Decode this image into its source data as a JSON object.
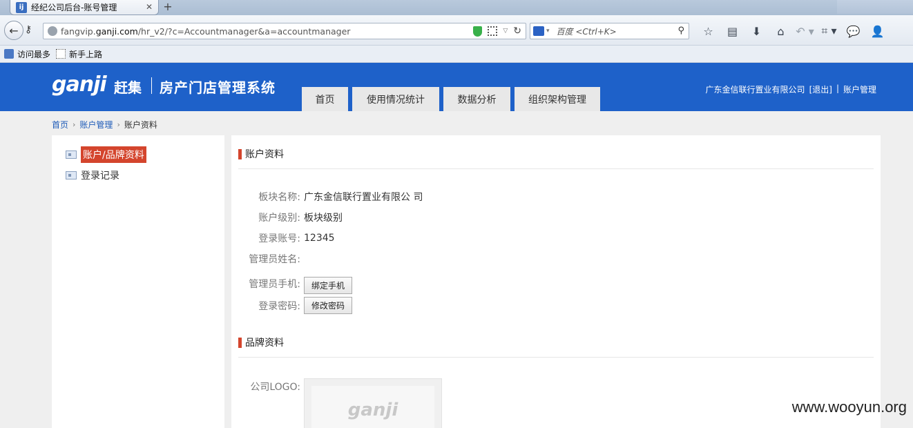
{
  "browser": {
    "tab_title": "经纪公司后台-账号管理",
    "tab_favicon_text": "ij",
    "url_host_prefix": "fangvip.",
    "url_host_main": "ganji.com",
    "url_path": "/hr_v2/?c=Accountmanager&a=accountmanager",
    "search_placeholder": "百度 <Ctrl+K>",
    "bookmarks": [
      "访问最多",
      "新手上路"
    ],
    "toolbar_icons": [
      "star-icon",
      "clipboard-icon",
      "download-icon",
      "home-icon",
      "undo-icon",
      "crop-icon",
      "chat-icon",
      "user-icon"
    ]
  },
  "header": {
    "logo_text": "ganji",
    "logo_cn": "赶集",
    "system_title": "房产门店管理系统",
    "nav_tabs": [
      "首页",
      "使用情况统计",
      "数据分析",
      "组织架构管理"
    ],
    "company": "广东金信联行置业有限公司",
    "logout": "[退出]",
    "divider": "|",
    "account_mgmt": "账户管理"
  },
  "breadcrumb": {
    "home": "首页",
    "account": "账户管理",
    "current": "账户资料",
    "separator": "›"
  },
  "sidebar": {
    "items": [
      {
        "label": "账户/品牌资料",
        "active": true
      },
      {
        "label": "登录记录",
        "active": false
      }
    ]
  },
  "account_section": {
    "title": "账户资料",
    "fields": {
      "block_name_label": "板块名称:",
      "block_name_value": "广东金信联行置业有限公 司",
      "account_level_label": "账户级别:",
      "account_level_value": "板块级别",
      "login_account_label": "登录账号:",
      "login_account_value": "12345",
      "admin_name_label": "管理员姓名:",
      "admin_phone_label": "管理员手机:",
      "bind_phone_button": "绑定手机",
      "password_label": "登录密码:",
      "change_password_button": "修改密码"
    }
  },
  "brand_section": {
    "title": "品牌资料",
    "logo_label": "公司LOGO:",
    "logo_placeholder_text": "ganji"
  },
  "watermark": "www.wooyun.org",
  "colors": {
    "header_blue": "#1e61c9",
    "accent_red": "#d4452d",
    "link_blue": "#1e5bb8"
  }
}
